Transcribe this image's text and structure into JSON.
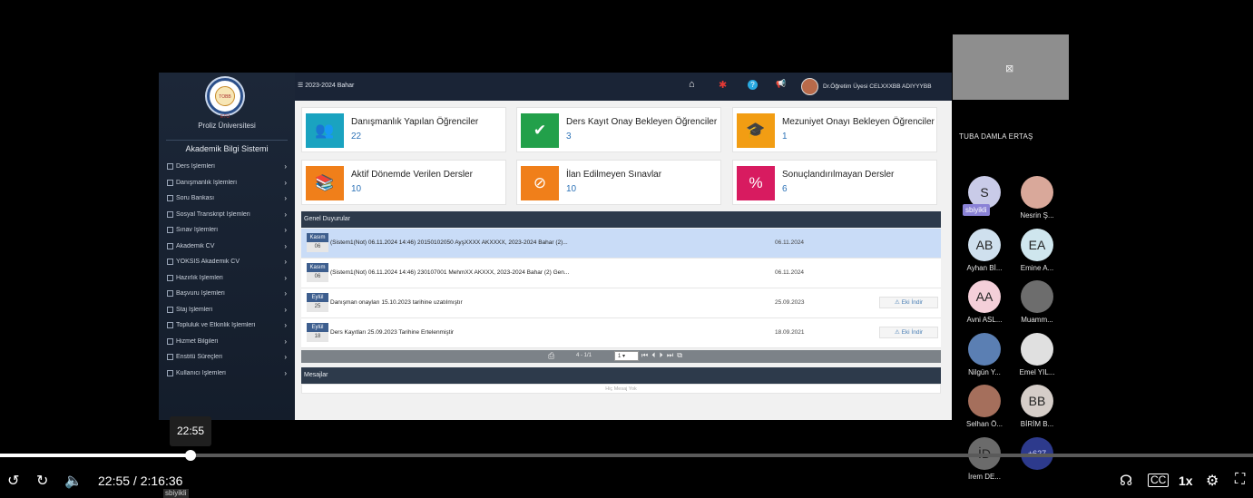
{
  "sidebar": {
    "logo_text": "TOBB ETÜ",
    "university": "Proliz Üniversitesi",
    "system_title": "Akademik Bilgi Sistemi",
    "items": [
      {
        "label": "Ders İşlemleri"
      },
      {
        "label": "Danışmanlık İşlemleri"
      },
      {
        "label": "Soru Bankası"
      },
      {
        "label": "Sosyal Transkript İşlemleri"
      },
      {
        "label": "Sınav İşlemleri"
      },
      {
        "label": "Akademik CV"
      },
      {
        "label": "YÖKSİS Akademik CV"
      },
      {
        "label": "Hazırlık İşlemleri"
      },
      {
        "label": "Başvuru İşlemleri"
      },
      {
        "label": "Staj İşlemleri"
      },
      {
        "label": "Topluluk ve Etkinlik İşlemleri"
      },
      {
        "label": "Hizmet Bilgileri"
      },
      {
        "label": "Enstitü Süreçleri"
      },
      {
        "label": "Kullanıcı İşlemleri"
      }
    ],
    "arrow": "›"
  },
  "topbar": {
    "term": "2023-2024 Bahar",
    "home_icon": "⌂",
    "bug_icon": "✱",
    "help_icon": "?",
    "notify_icon": "📢",
    "user_name": "Dr.Öğretim Üyesi CELXXXBB ADIYYYBB"
  },
  "cards": [
    {
      "title": "Danışmanlık Yapılan Öğrenciler",
      "count": "22",
      "color": "#1aa3c0",
      "icon": "👥"
    },
    {
      "title": "Ders Kayıt Onay Bekleyen Öğrenciler",
      "count": "3",
      "color": "#22a04a",
      "icon": "✔"
    },
    {
      "title": "Mezuniyet Onayı Bekleyen Öğrenciler",
      "count": "1",
      "color": "#f29d13",
      "icon": "🎓"
    },
    {
      "title": "Aktif Dönemde Verilen Dersler",
      "count": "10",
      "color": "#f07f1a",
      "icon": "📚"
    },
    {
      "title": "İlan Edilmeyen Sınavlar",
      "count": "10",
      "color": "#f07f1a",
      "icon": "⊘"
    },
    {
      "title": "Sonuçlandırılmayan Dersler",
      "count": "6",
      "color": "#d81b60",
      "icon": "%"
    }
  ],
  "announcements": {
    "header": "Genel Duyurular",
    "rows": [
      {
        "month": "Kasım",
        "day": "06",
        "text": "(Sistem1(Not) 06.11.2024 14:46) 20150102050 AyşXXXX AKXXXX, 2023-2024 Bahar (2)...",
        "date": "06.11.2024",
        "attachment": ""
      },
      {
        "month": "Kasım",
        "day": "06",
        "text": "(Sistem1(Not) 06.11.2024 14:46) 230107001 MehmXX AKXXX, 2023-2024 Bahar (2) Gen...",
        "date": "06.11.2024",
        "attachment": ""
      },
      {
        "month": "Eylül",
        "day": "25",
        "text": "Danışman onayları 15.10.2023 tarihine uzatılmıştır",
        "date": "25.09.2023",
        "attachment": "Eki İndir"
      },
      {
        "month": "Eylül",
        "day": "18",
        "text": "Ders Kayıtları 25.09.2023 Tarihine Ertelenmiştir",
        "date": "18.09.2021",
        "attachment": "Eki İndir"
      }
    ],
    "pager": {
      "info": "4 - 1/1",
      "page": "1",
      "nav": "⏮ ⏴ ⏵ ⏭ ⧉"
    }
  },
  "messages": {
    "header": "Mesajlar",
    "empty": "Hiç Mesaj Yok"
  },
  "participants": {
    "presenter": "TUBA DAMLA ERTAŞ",
    "speaking_tag": "sbiyikli",
    "overflow": "+627",
    "list": [
      {
        "initials": "S",
        "name": "",
        "color": "#c9cbe8"
      },
      {
        "initials": "",
        "name": "Nesrin Ş...",
        "color": "#d9a89a"
      },
      {
        "initials": "AB",
        "name": "Ayhan Bİ...",
        "color": "#cfe0ee"
      },
      {
        "initials": "EA",
        "name": "Emine A...",
        "color": "#cfe6ee"
      },
      {
        "initials": "AA",
        "name": "Avni ASL...",
        "color": "#f4cfd9"
      },
      {
        "initials": "",
        "name": "Muamm...",
        "color": "#6d6d6d"
      },
      {
        "initials": "",
        "name": "Nilgün Y...",
        "color": "#5b7fb3"
      },
      {
        "initials": "",
        "name": "Emel YIL...",
        "color": "#e0e0e0"
      },
      {
        "initials": "",
        "name": "Selhan Ö...",
        "color": "#a56f5c"
      },
      {
        "initials": "BB",
        "name": "BİRİM B...",
        "color": "#d5cdc8"
      },
      {
        "initials": "İD",
        "name": "İrem DE...",
        "color": "#6b6b6b"
      }
    ]
  },
  "player": {
    "hover_time": "22:55",
    "current": "22:55",
    "total": "2:16:36",
    "progress": 0.152,
    "speed": "1x",
    "bottom_tag": "sbiyikli"
  }
}
